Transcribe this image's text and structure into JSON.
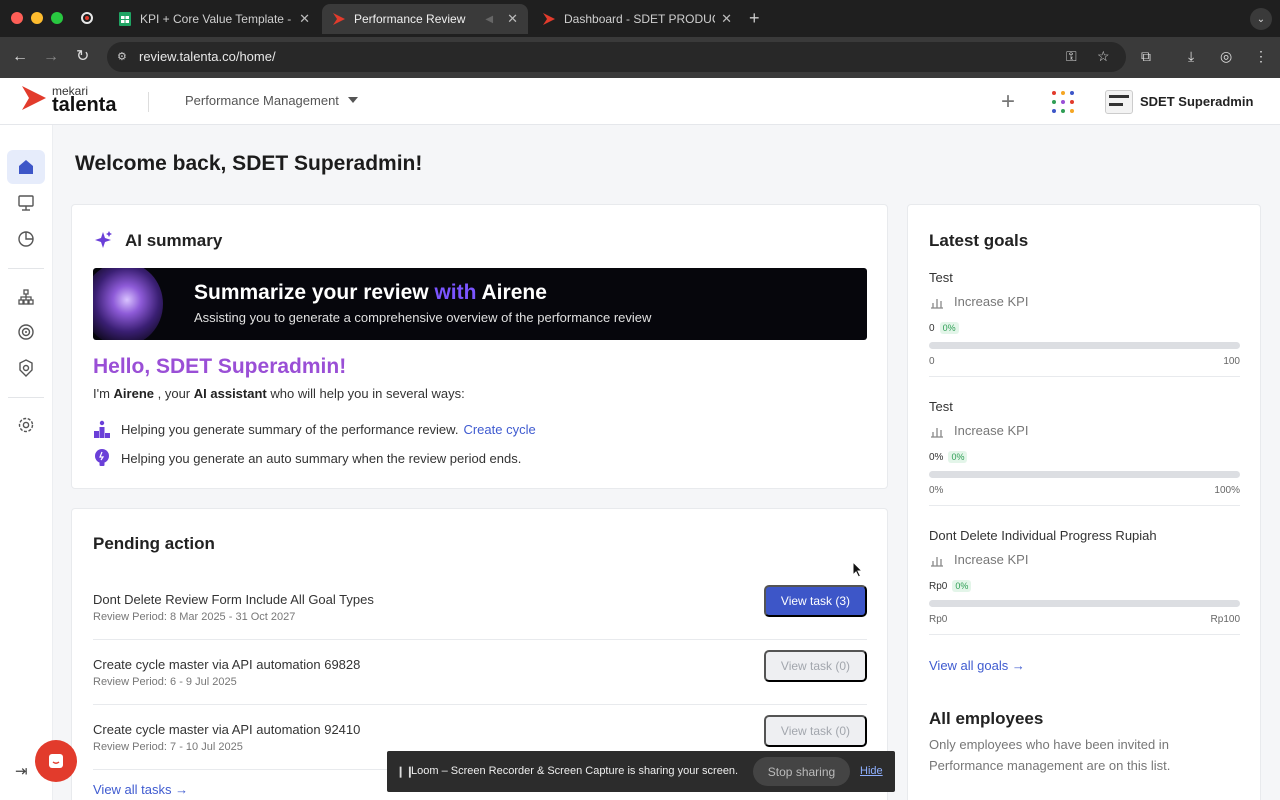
{
  "browser": {
    "tabs": [
      {
        "title": "KPI + Core Value Template - G",
        "active": false
      },
      {
        "title": "Performance Review",
        "active": true
      },
      {
        "title": "Dashboard - SDET PRODUCT",
        "active": false
      }
    ],
    "url": "review.talenta.co/home/"
  },
  "header": {
    "brand_small": "mekari",
    "brand_big": "talenta",
    "module": "Performance Management",
    "user_name": "SDET Superadmin"
  },
  "sidebar": {
    "items": [
      "home-icon",
      "monitor-icon",
      "pie-chart-icon",
      "hierarchy-icon",
      "target-icon",
      "badge-icon",
      "settings-icon"
    ]
  },
  "main": {
    "welcome": "Welcome back, SDET Superadmin!",
    "ai_summary": {
      "title": "AI summary",
      "banner_title_pre": "Summarize your review",
      "banner_title_with": "with",
      "banner_title_post": "Airene",
      "banner_subtitle": "Assisting you to generate a comprehensive overview of the performance review",
      "hello": "Hello, SDET Superadmin!",
      "intro_pre": "I'm ",
      "intro_name": "Airene",
      "intro_mid": " , your ",
      "intro_role": "AI assistant",
      "intro_post": " who will help you in several ways:",
      "help_1": "Helping you generate summary of the performance review.",
      "help_1_link": "Create cycle",
      "help_2": "Helping you generate an auto summary when the review period ends."
    },
    "pending": {
      "title": "Pending action",
      "tasks": [
        {
          "name": "Dont Delete Review Form Include All Goal Types",
          "period": "Review Period: 8 Mar 2025 - 31 Oct 2027",
          "button": "View task (3)"
        },
        {
          "name": "Create cycle master via API automation 69828",
          "period": "Review Period: 6 - 9 Jul 2025",
          "button": "View task (0)"
        },
        {
          "name": "Create cycle master via API automation 92410",
          "period": "Review Period: 7 - 10 Jul 2025",
          "button": "View task (0)"
        }
      ],
      "view_all": "View all tasks"
    }
  },
  "goals": {
    "title": "Latest goals",
    "items": [
      {
        "name": "Test",
        "type": "Increase KPI",
        "current": "0",
        "percent": "0%",
        "progress": 0,
        "min": "0",
        "max": "100"
      },
      {
        "name": "Test",
        "type": "Increase KPI",
        "current": "0%",
        "percent": "0%",
        "progress": 0,
        "min": "0%",
        "max": "100%"
      },
      {
        "name": "Dont Delete Individual Progress Rupiah",
        "type": "Increase KPI",
        "current": "Rp0",
        "percent": "0%",
        "progress": 0,
        "min": "Rp0",
        "max": "Rp100"
      }
    ],
    "view_all": "View all goals",
    "all_employees_title": "All employees",
    "all_employees_desc": "Only employees who have been invited in Performance management are on this list."
  },
  "loom": {
    "message": "Loom – Screen Recorder & Screen Capture is sharing your screen.",
    "stop": "Stop sharing",
    "hide": "Hide"
  },
  "colors": {
    "accent": "#3d56c8",
    "brand_red": "#e23b2c",
    "ai_purple": "#9a4fd6"
  }
}
